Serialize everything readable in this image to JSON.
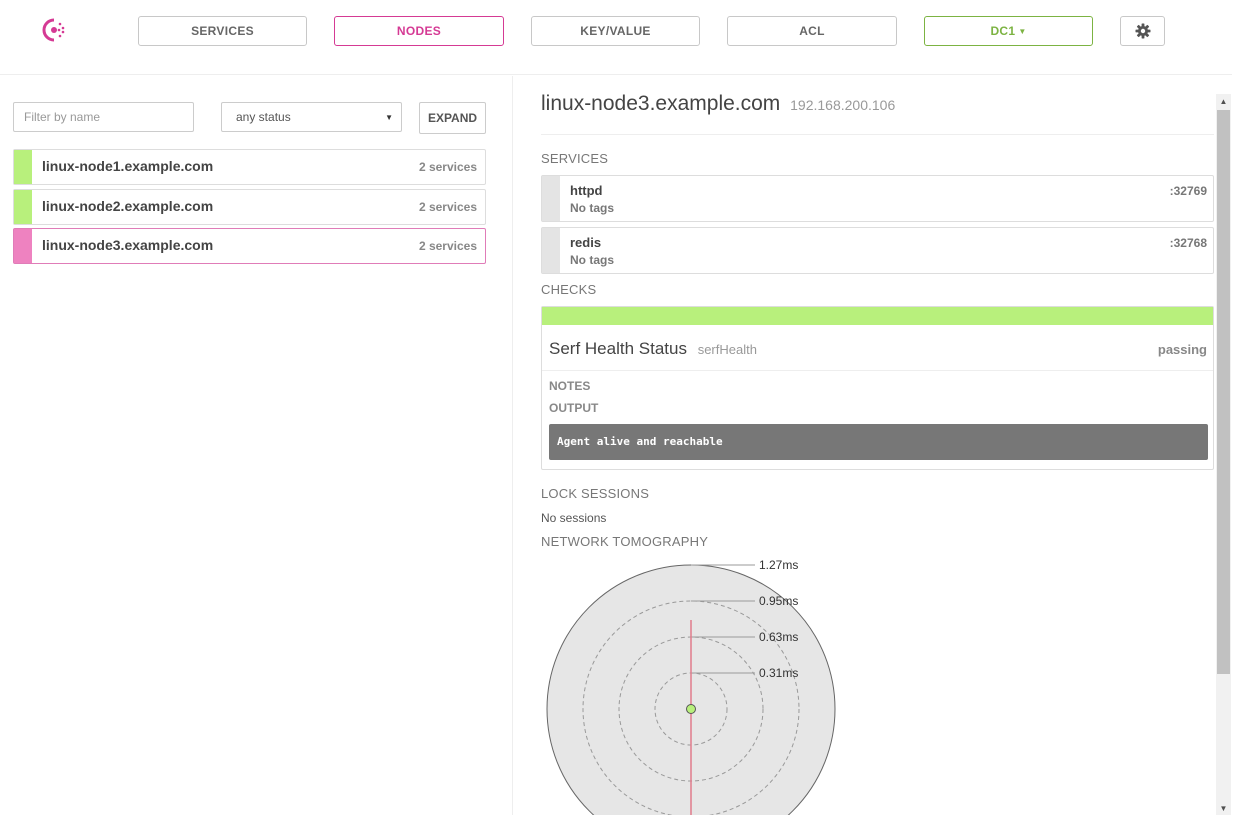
{
  "nav": {
    "services": "SERVICES",
    "nodes": "NODES",
    "keyvalue": "KEY/VALUE",
    "acl": "ACL",
    "datacenter": "DC1"
  },
  "filters": {
    "name_placeholder": "Filter by name",
    "status": "any status",
    "expand": "EXPAND"
  },
  "nodes": [
    {
      "name": "linux-node1.example.com",
      "services": "2 services",
      "status": "passing"
    },
    {
      "name": "linux-node2.example.com",
      "services": "2 services",
      "status": "passing"
    },
    {
      "name": "linux-node3.example.com",
      "services": "2 services",
      "status": "selected"
    }
  ],
  "detail": {
    "node_name": "linux-node3.example.com",
    "address": "192.168.200.106",
    "services_heading": "SERVICES",
    "services": [
      {
        "name": "httpd",
        "tags": "No tags",
        "port": ":32769"
      },
      {
        "name": "redis",
        "tags": "No tags",
        "port": ":32768"
      }
    ],
    "checks_heading": "CHECKS",
    "check": {
      "name": "Serf Health Status",
      "id": "serfHealth",
      "status": "passing",
      "notes_label": "NOTES",
      "output_label": "OUTPUT",
      "output": "Agent alive and reachable"
    },
    "sessions_heading": "LOCK SESSIONS",
    "sessions_text": "No sessions",
    "tomography_heading": "NETWORK TOMOGRAPHY",
    "tomography_rings": [
      "1.27ms",
      "0.95ms",
      "0.63ms",
      "0.31ms"
    ]
  },
  "colors": {
    "accent": "#d53a94",
    "passing": "#b8f07c",
    "selected": "#ee82c0",
    "dc": "#7cb342"
  }
}
